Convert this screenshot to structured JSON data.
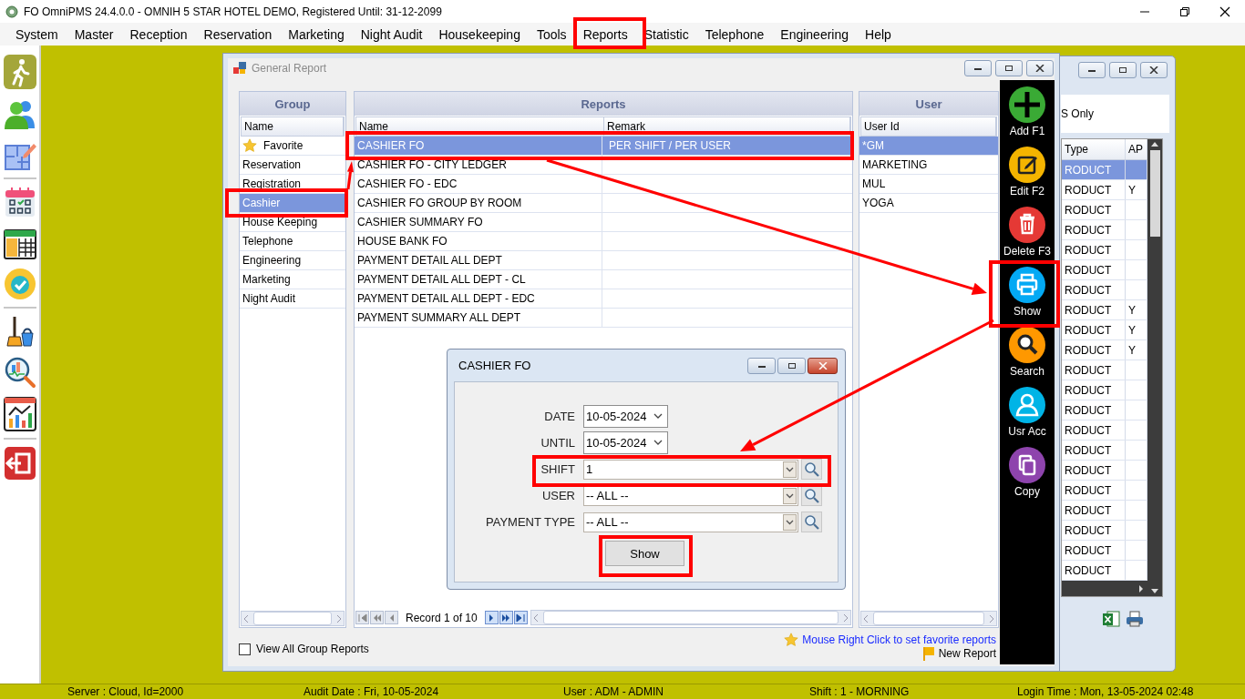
{
  "window": {
    "title": "FO OmniPMS 24.4.0.0 - OMNIH 5 STAR HOTEL DEMO, Registered Until: 31-12-2099"
  },
  "menu": [
    "System",
    "Master",
    "Reception",
    "Reservation",
    "Marketing",
    "Night Audit",
    "Housekeeping",
    "Tools",
    "Reports",
    "Statistic",
    "Telephone",
    "Engineering",
    "Help"
  ],
  "general_report": {
    "title": "General Report",
    "group": {
      "heading": "Group",
      "column": "Name",
      "items": [
        {
          "label": "Favorite",
          "kind": "favorite",
          "selected": false
        },
        {
          "label": "Reservation",
          "kind": "group",
          "selected": false
        },
        {
          "label": "Registration",
          "kind": "group",
          "selected": false
        },
        {
          "label": "Cashier",
          "kind": "group",
          "selected": true
        },
        {
          "label": "House Keeping",
          "kind": "group",
          "selected": false
        },
        {
          "label": "Telephone",
          "kind": "group",
          "selected": false
        },
        {
          "label": "Engineering",
          "kind": "group",
          "selected": false
        },
        {
          "label": "Marketing",
          "kind": "group",
          "selected": false
        },
        {
          "label": "Night Audit",
          "kind": "group",
          "selected": false
        }
      ]
    },
    "reports": {
      "heading": "Reports",
      "columns": [
        "Name",
        "Remark"
      ],
      "rows": [
        {
          "name": "CASHIER FO",
          "remark": "PER SHIFT / PER USER",
          "selected": true
        },
        {
          "name": "CASHIER FO - CITY LEDGER",
          "selected": false
        },
        {
          "name": "CASHIER FO - EDC",
          "selected": false
        },
        {
          "name": "CASHIER FO GROUP BY ROOM",
          "selected": false
        },
        {
          "name": "CASHIER SUMMARY FO",
          "selected": false
        },
        {
          "name": "HOUSE BANK FO",
          "selected": false
        },
        {
          "name": "PAYMENT DETAIL ALL DEPT",
          "selected": false
        },
        {
          "name": "PAYMENT DETAIL ALL DEPT - CL",
          "selected": false
        },
        {
          "name": "PAYMENT DETAIL ALL DEPT - EDC",
          "selected": false
        },
        {
          "name": "PAYMENT SUMMARY ALL DEPT",
          "selected": false
        }
      ],
      "record": "Record 1 of 10"
    },
    "user": {
      "heading": "User",
      "column": "User Id",
      "rows": [
        {
          "id": "*GM",
          "selected": true
        },
        {
          "id": "MARKETING",
          "selected": false
        },
        {
          "id": "MUL",
          "selected": false
        },
        {
          "id": "YOGA",
          "selected": false
        }
      ]
    },
    "view_all": {
      "label": "View All Group Reports",
      "checked": false
    },
    "favorite_hint": "Mouse Right Click to set favorite reports",
    "new_report": "New Report"
  },
  "toolbar": [
    {
      "label": "Add F1",
      "kind": "add"
    },
    {
      "label": "Edit F2",
      "kind": "edit"
    },
    {
      "label": "Delete F3",
      "kind": "delete"
    },
    {
      "label": "Show",
      "kind": "show"
    },
    {
      "label": "Search",
      "kind": "search"
    },
    {
      "label": "Usr Acc",
      "kind": "user"
    },
    {
      "label": "Copy",
      "kind": "copy"
    }
  ],
  "background_window": {
    "filter_text": "S Only",
    "columns": [
      "Type",
      "AP"
    ],
    "rows": [
      {
        "type": "RODUCT",
        "ap": "",
        "selected": true
      },
      {
        "type": "RODUCT",
        "ap": "Y",
        "selected": false
      },
      {
        "type": "RODUCT",
        "ap": "",
        "selected": false
      },
      {
        "type": "RODUCT",
        "ap": "",
        "selected": false
      },
      {
        "type": "RODUCT",
        "ap": "",
        "selected": false
      },
      {
        "type": "RODUCT",
        "ap": "",
        "selected": false
      },
      {
        "type": "RODUCT",
        "ap": "",
        "selected": false
      },
      {
        "type": "RODUCT",
        "ap": "Y",
        "selected": false
      },
      {
        "type": "RODUCT",
        "ap": "Y",
        "selected": false
      },
      {
        "type": "RODUCT",
        "ap": "Y",
        "selected": false
      },
      {
        "type": "RODUCT",
        "ap": "",
        "selected": false
      },
      {
        "type": "RODUCT",
        "ap": "",
        "selected": false
      },
      {
        "type": "RODUCT",
        "ap": "",
        "selected": false
      },
      {
        "type": "RODUCT",
        "ap": "",
        "selected": false
      },
      {
        "type": "RODUCT",
        "ap": "",
        "selected": false
      },
      {
        "type": "RODUCT",
        "ap": "",
        "selected": false
      },
      {
        "type": "RODUCT",
        "ap": "",
        "selected": false
      },
      {
        "type": "RODUCT",
        "ap": "",
        "selected": false
      },
      {
        "type": "RODUCT",
        "ap": "",
        "selected": false
      },
      {
        "type": "RODUCT",
        "ap": "",
        "selected": false
      },
      {
        "type": "RODUCT",
        "ap": "",
        "selected": false
      }
    ]
  },
  "dialog": {
    "title": "CASHIER FO",
    "fields": [
      {
        "label": "DATE",
        "value": "10-05-2024",
        "kind": "date"
      },
      {
        "label": "UNTIL",
        "value": "10-05-2024",
        "kind": "date"
      },
      {
        "label": "SHIFT",
        "value": "1",
        "kind": "lookup"
      },
      {
        "label": "USER",
        "value": "-- ALL --",
        "kind": "lookup"
      },
      {
        "label": "PAYMENT TYPE",
        "value": "-- ALL --",
        "kind": "lookup"
      }
    ],
    "button": "Show"
  },
  "status_bar": [
    "Server : Cloud, Id=2000",
    "Audit Date : Fri, 10-05-2024",
    "User : ADM - ADMIN",
    "Shift : 1 - MORNING",
    "Login Time : Mon, 13-05-2024 02:48"
  ]
}
